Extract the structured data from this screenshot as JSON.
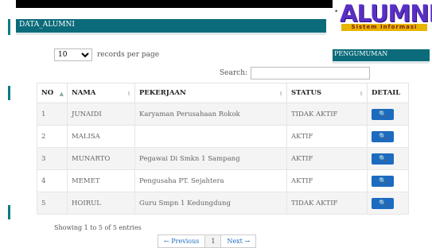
{
  "logo": {
    "word": "ALUMNI",
    "sub": "Sistem Informasi"
  },
  "bullet": "•",
  "data_header": "DATA_ALUMNI",
  "pengumuman_header": "PENGUMUMAN",
  "records": {
    "selected": "10",
    "suffix": "records per page"
  },
  "search": {
    "label": "Search:",
    "value": ""
  },
  "table": {
    "columns": [
      "NO",
      "NAMA",
      "PEKERJAAN",
      "STATUS",
      "DETAIL"
    ],
    "rows": [
      {
        "no": "1",
        "nama": "JUNAIDI",
        "pekerjaan": "Karyaman Perusahaan Rokok",
        "status": "TIDAK AKTIF"
      },
      {
        "no": "2",
        "nama": "MALISA",
        "pekerjaan": "",
        "status": "AKTIF"
      },
      {
        "no": "3",
        "nama": "MUNARTO",
        "pekerjaan": "Pegawai Di Smkn 1 Sampang",
        "status": "AKTIF"
      },
      {
        "no": "4",
        "nama": "MEMET",
        "pekerjaan": "Pengusaha PT. Sejahtera",
        "status": "AKTIF"
      },
      {
        "no": "5",
        "nama": "HOIRUL",
        "pekerjaan": "Guru Smpn 1 Kedungdung",
        "status": "TIDAK AKTIF"
      }
    ],
    "detail_icon": "🔍"
  },
  "info": "Showing 1 to 5 of 5 entries",
  "pagination": {
    "prev": "← Previous",
    "page": "1",
    "next": "Next →"
  },
  "colors": {
    "header_bg": "#0b6b7a",
    "button": "#1c6bbf",
    "logo": "#5a2fc6"
  }
}
